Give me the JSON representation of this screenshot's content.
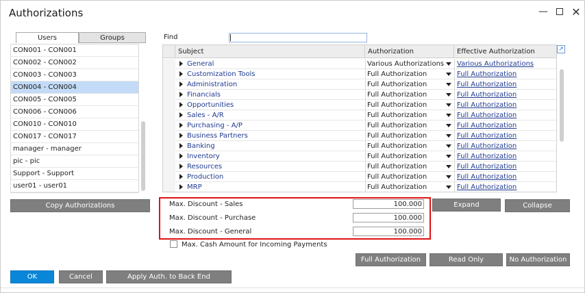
{
  "window": {
    "title": "Authorizations"
  },
  "tabs": [
    {
      "label": "Users"
    },
    {
      "label": "Groups"
    }
  ],
  "users": [
    "CON001 - CON001",
    "CON002 - CON002",
    "CON003 - CON003",
    "CON004 - CON004",
    "CON005 - CON005",
    "CON006 - CON006",
    "CON010 - CON010",
    "CON017 - CON017",
    "manager - manager",
    "pic - pic",
    "Support - Support",
    "user01 - user01"
  ],
  "selected_user": "CON004 - CON004",
  "find": {
    "label": "Find",
    "value": ""
  },
  "grid": {
    "headers": {
      "subject": "Subject",
      "authorization": "Authorization",
      "effective": "Effective Authorization"
    },
    "rows": [
      {
        "subject": "General",
        "authorization": "Various Authorizations",
        "effective": "Various Authorizations"
      },
      {
        "subject": "Customization Tools",
        "authorization": "Full Authorization",
        "effective": "Full Authorization"
      },
      {
        "subject": "Administration",
        "authorization": "Full Authorization",
        "effective": "Full Authorization"
      },
      {
        "subject": "Financials",
        "authorization": "Full Authorization",
        "effective": "Full Authorization"
      },
      {
        "subject": "Opportunities",
        "authorization": "Full Authorization",
        "effective": "Full Authorization"
      },
      {
        "subject": "Sales - A/R",
        "authorization": "Full Authorization",
        "effective": "Full Authorization"
      },
      {
        "subject": "Purchasing - A/P",
        "authorization": "Full Authorization",
        "effective": "Full Authorization"
      },
      {
        "subject": "Business Partners",
        "authorization": "Full Authorization",
        "effective": "Full Authorization"
      },
      {
        "subject": "Banking",
        "authorization": "Full Authorization",
        "effective": "Full Authorization"
      },
      {
        "subject": "Inventory",
        "authorization": "Full Authorization",
        "effective": "Full Authorization"
      },
      {
        "subject": "Resources",
        "authorization": "Full Authorization",
        "effective": "Full Authorization"
      },
      {
        "subject": "Production",
        "authorization": "Full Authorization",
        "effective": "Full Authorization"
      },
      {
        "subject": "MRP",
        "authorization": "Full Authorization",
        "effective": "Full Authorization"
      }
    ]
  },
  "discounts": [
    {
      "label": "Max. Discount - Sales",
      "value": "100.000"
    },
    {
      "label": "Max. Discount - Purchase",
      "value": "100.000"
    },
    {
      "label": "Max. Discount - General",
      "value": "100.000"
    }
  ],
  "cash_amount": {
    "label": "Max. Cash Amount for Incoming Payments",
    "checked": false
  },
  "buttons": {
    "copy_authorizations": "Copy Authorizations",
    "expand": "Expand",
    "collapse": "Collapse",
    "full_authorization": "Full Authorization",
    "read_only": "Read Only",
    "no_authorization": "No Authorization",
    "ok": "OK",
    "cancel": "Cancel",
    "apply_auth": "Apply Auth. to Back End"
  },
  "icons": {
    "minimize": "minimize-icon",
    "maximize": "maximize-icon",
    "close": "close-icon",
    "expand_grid": "expand-arrow-icon"
  },
  "colors": {
    "accent": "#0a86d8",
    "selection": "#c3dbf7",
    "highlight_box": "#e01010",
    "link": "#1f3a8f"
  }
}
